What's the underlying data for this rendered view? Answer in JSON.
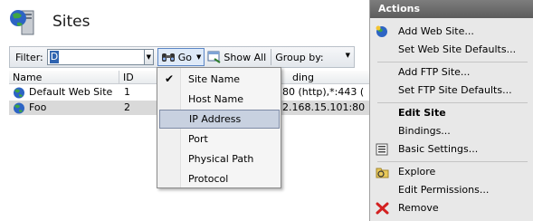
{
  "header": {
    "title": "Sites"
  },
  "filterbar": {
    "filter_label": "Filter:",
    "filter_value": "D",
    "go_label": "Go",
    "show_all_label": "Show All",
    "group_by_label": "Group by:"
  },
  "grid": {
    "columns": [
      "Name",
      "ID",
      "ding"
    ],
    "rows": [
      {
        "name": "Default Web Site",
        "id": "1",
        "binding": "80 (http),*:443 ("
      },
      {
        "name": "Foo",
        "id": "2",
        "binding": "2.168.15.101:80"
      }
    ]
  },
  "menu": {
    "items": [
      "Site Name",
      "Host Name",
      "IP Address",
      "Port",
      "Physical Path",
      "Protocol"
    ],
    "checked_index": 0,
    "highlighted_index": 2
  },
  "actions": {
    "title": "Actions",
    "items": [
      "Add Web Site...",
      "Set Web Site Defaults...",
      "Add FTP Site...",
      "Set FTP Site Defaults...",
      "Edit Site",
      "Bindings...",
      "Basic Settings...",
      "Explore",
      "Edit Permissions...",
      "Remove"
    ]
  },
  "colors": {
    "selection": "#3064b0",
    "menu_highlight": "#c8d1e0",
    "actions_header": "#6a6a6a"
  }
}
